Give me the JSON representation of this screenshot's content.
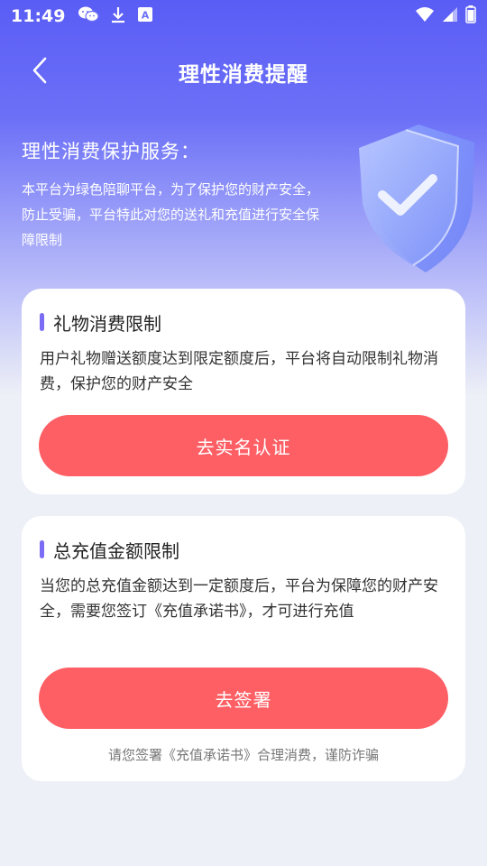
{
  "status_bar": {
    "time": "11:49",
    "icons_left": [
      "wechat-icon",
      "download-icon",
      "keyboard-icon"
    ],
    "icons_right": [
      "wifi-icon",
      "signal-icon",
      "battery-icon"
    ]
  },
  "nav": {
    "title": "理性消费提醒",
    "back_icon": "chevron-left-icon"
  },
  "intro": {
    "title": "理性消费保护服务：",
    "description": "本平台为绿色陪聊平台，为了保护您的财产安全，防止受骗，平台特此对您的送礼和充值进行安全保障限制"
  },
  "cards": [
    {
      "title": "礼物消费限制",
      "description": "用户礼物赠送额度达到限定额度后，平台将自动限制礼物消费，保护您的财产安全",
      "button_label": "去实名认证"
    },
    {
      "title": "总充值金额限制",
      "description": "当您的总充值金额达到一定额度后，平台为保障您的财产安全，需要您签订《充值承诺书》，才可进行充值",
      "button_label": "去签署",
      "note": "请您签署《充值承诺书》合理消费，谨防诈骗"
    }
  ],
  "colors": {
    "primary": "#5a5df5",
    "button": "#fd5f65",
    "accent_bar": "#7b6cf6",
    "background": "#eef0f7"
  }
}
